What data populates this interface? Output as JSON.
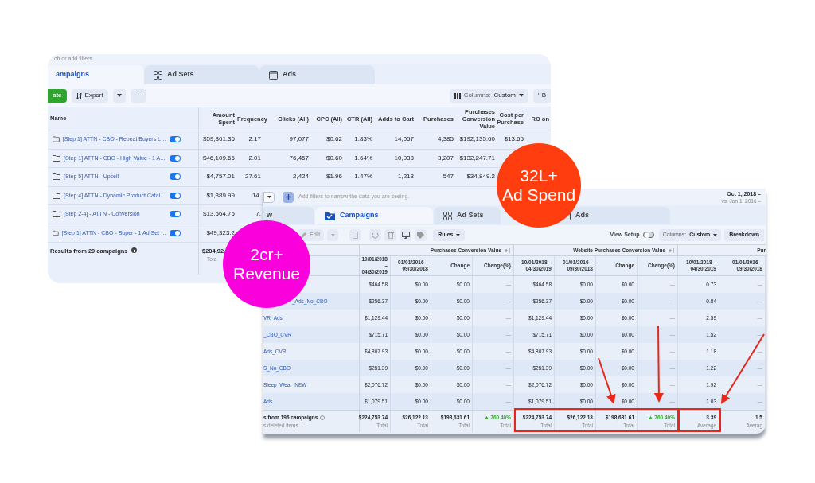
{
  "back_window": {
    "filter_placeholder": "ch or add filters",
    "tabs": [
      {
        "label": "ampaigns",
        "selected": true,
        "kind": "none"
      },
      {
        "label": "Ad Sets",
        "selected": false,
        "kind": "grid"
      },
      {
        "label": "Ads",
        "selected": false,
        "kind": "frame"
      }
    ],
    "toolbar": {
      "create": "ate",
      "export": "Export",
      "more": "···",
      "columns_label": "Columns:",
      "columns_value": "Custom",
      "breakdown": "B"
    },
    "name_header": "Name",
    "columns": [
      "Amount Spent",
      "Frequency",
      "Clicks (All)",
      "CPC (All)",
      "CTR (All)",
      "Adds to Cart",
      "Purchases",
      "Purchases Conversion Value",
      "Cost per Purchase",
      "RO on"
    ],
    "rows": [
      {
        "name": "[Step 1] ATTN - CBO - Repeat Buyers L…",
        "on": true,
        "cells": [
          "$59,861.36",
          "2.17",
          "97,077",
          "$0.62",
          "1.83%",
          "14,057",
          "4,385",
          "$192,135.60",
          "$13.65"
        ]
      },
      {
        "name": "[Step 1] ATTN - CBO - High Value - 1 A…",
        "on": true,
        "cells": [
          "$46,109.66",
          "2.01",
          "76,457",
          "$0.60",
          "1.64%",
          "10,933",
          "3,207",
          "$132,247.71"
        ]
      },
      {
        "name": "[Step 5] ATTN - Upsell",
        "on": true,
        "cells": [
          "$4,757.01",
          "27.61",
          "2,424",
          "$1.96",
          "1.47%",
          "1,213",
          "547",
          "$34,849.2"
        ]
      },
      {
        "name": "[Step 4] ATTN - Dynamic Product Catal…",
        "on": true,
        "cells": [
          "$1,389.99",
          "14."
        ]
      },
      {
        "name": "[Step 2-4] - ATTN - Conversion",
        "on": true,
        "cells": [
          "$13,564.75",
          "7."
        ]
      },
      {
        "name": "[Step 1] ATTN - CBO - Super - 1 Ad Set …",
        "on": true,
        "cells": [
          "$49,323.2"
        ]
      }
    ],
    "footer": {
      "label": "Results from 29 campaigns",
      "total": "$204,92",
      "caption": "Tota"
    }
  },
  "front_window": {
    "filter_placeholder": "Add filters to narrow the data you are seeing.",
    "date_range": "Oct 1, 2018 –",
    "compare_range": "vs. Jan 1, 2016 –",
    "tabs": [
      {
        "label": "w",
        "selected": false,
        "kind": "none"
      },
      {
        "label": "Campaigns",
        "selected": true,
        "kind": "folder"
      },
      {
        "label": "Ad Sets",
        "selected": false,
        "kind": "grid"
      },
      {
        "label": "Ads",
        "selected": false,
        "kind": "frame"
      }
    ],
    "toolbar": {
      "edit": "Edit",
      "rules": "Rules",
      "view_setup": "View Setup",
      "view_setup_on": false,
      "columns_label": "Columns:",
      "columns_value": "Custom",
      "breakdown": "Breakdown"
    },
    "groups": [
      "Purchases Conversion Value",
      "Website Purchases Conversion Value",
      "Pur"
    ],
    "columns": [
      "10/01/2018 – 04/30/2019",
      "01/01/2016 – 09/30/2018",
      "Change",
      "Change(%)",
      "10/01/2018 – 04/30/2019",
      "01/01/2016 – 09/30/2018",
      "Change",
      "Change(%)",
      "10/01/2018 – 04/30/2019",
      "01/01/2016 – 09/30/2018"
    ],
    "rows": [
      {
        "cells": [
          "$464.58",
          "$0.00",
          "$0.00",
          "—",
          "$464.58",
          "$0.00",
          "$0.00",
          "—",
          "0.73",
          "—"
        ]
      },
      {
        "name": "_Ads_No_CBO",
        "cells": [
          "$256.37",
          "$0.00",
          "$0.00",
          "—",
          "$256.37",
          "$0.00",
          "$0.00",
          "—",
          "0.84",
          "—"
        ]
      },
      {
        "name": "VR_Ads",
        "cells": [
          "$1,129.44",
          "$0.00",
          "$0.00",
          "—",
          "$1,129.44",
          "$0.00",
          "$0.00",
          "—",
          "2.59",
          "—"
        ]
      },
      {
        "name": "_CBO_CVR",
        "cells": [
          "$715.71",
          "$0.00",
          "$0.00",
          "—",
          "$715.71",
          "$0.00",
          "$0.00",
          "—",
          "1.52",
          "—"
        ]
      },
      {
        "name": "Ads_CVR",
        "cells": [
          "$4,807.93",
          "$0.00",
          "$0.00",
          "—",
          "$4,807.93",
          "$0.00",
          "$0.00",
          "—",
          "1.18",
          "—"
        ]
      },
      {
        "name": "S_No_CBO",
        "cells": [
          "$251.39",
          "$0.00",
          "$0.00",
          "—",
          "$251.39",
          "$0.00",
          "$0.00",
          "—",
          "1.22",
          "—"
        ]
      },
      {
        "name": "Sleep_Wear_NEW",
        "cells": [
          "$2,076.72",
          "$0.00",
          "$0.00",
          "—",
          "$2,076.72",
          "$0.00",
          "$0.00",
          "—",
          "1.92",
          "—"
        ]
      },
      {
        "name": "Ads",
        "cells": [
          "$1,079.51",
          "$0.00",
          "$0.00",
          "—",
          "$1,079.51",
          "$0.00",
          "$0.00",
          "—",
          "1.03",
          "—"
        ]
      }
    ],
    "footer": {
      "label": "s from 196 campaigns",
      "sublabel": "s deleted items",
      "totals": [
        {
          "value": "$224,753.74",
          "caption": "Total",
          "kind": "plain"
        },
        {
          "value": "$26,122.13",
          "caption": "Total",
          "kind": "plain"
        },
        {
          "value": "$198,631.61",
          "caption": "Total",
          "kind": "plain"
        },
        {
          "value": "760.40%",
          "caption": "Total",
          "kind": "up"
        },
        {
          "value": "$224,753.74",
          "caption": "Total",
          "kind": "plain"
        },
        {
          "value": "$26,122.13",
          "caption": "Total",
          "kind": "plain"
        },
        {
          "value": "$198,631.61",
          "caption": "Total",
          "kind": "plain"
        },
        {
          "value": "760.40%",
          "caption": "Total",
          "kind": "up"
        },
        {
          "value": "3.39",
          "caption": "Average",
          "kind": "plain"
        },
        {
          "value": "1.5",
          "caption": "Averag",
          "kind": "plain"
        }
      ]
    }
  },
  "badges": [
    {
      "lines": [
        "32L+",
        "Ad Spend"
      ],
      "color": "#ff3d0f"
    },
    {
      "lines": [
        "2cr+",
        "Revenue"
      ],
      "color": "#f900dc"
    }
  ]
}
